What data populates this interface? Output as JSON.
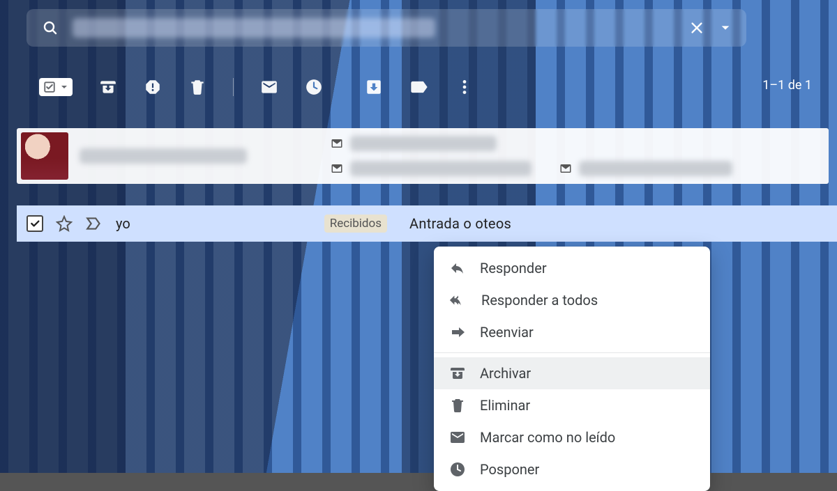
{
  "search": {
    "placeholder": ""
  },
  "toolbar": {
    "counter": "1–1 de 1"
  },
  "email": {
    "sender": "yo",
    "inbox_tag": "Recibidos",
    "subject": "Antrada o oteos"
  },
  "menu": {
    "reply": "Responder",
    "reply_all": "Responder a todos",
    "forward": "Reenviar",
    "archive": "Archivar",
    "delete": "Eliminar",
    "mark_unread": "Marcar como no leído",
    "snooze": "Posponer"
  }
}
